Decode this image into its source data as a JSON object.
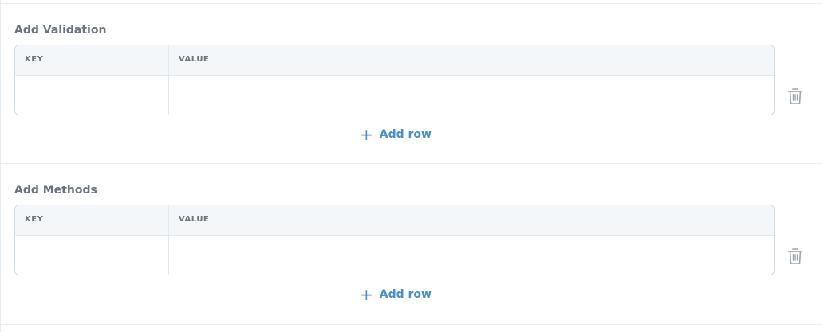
{
  "sections": [
    {
      "title": "Add Validation",
      "columns": {
        "key": "KEY",
        "value": "VALUE"
      },
      "row": {
        "key": "",
        "value": ""
      },
      "add_row_label": "Add row",
      "add_row_icon": "+"
    },
    {
      "title": "Add Methods",
      "columns": {
        "key": "KEY",
        "value": "VALUE"
      },
      "row": {
        "key": "",
        "value": ""
      },
      "add_row_label": "Add row",
      "add_row_icon": "+"
    }
  ],
  "colors": {
    "accent": "#4a8fc6",
    "label": "#6b7280",
    "table_border": "#cfdde8",
    "header_bg": "#f3f7fa"
  },
  "icons": {
    "delete": "trash-icon",
    "add": "plus-icon"
  }
}
